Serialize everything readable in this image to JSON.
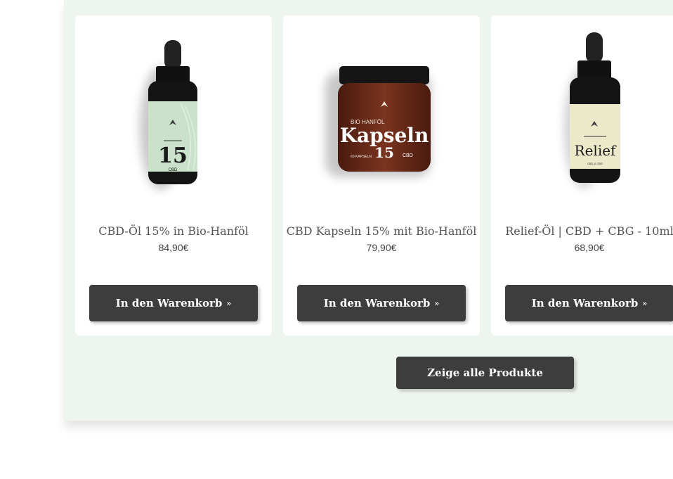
{
  "products": [
    {
      "title": "CBD-Öl 15% in Bio-Hanföl",
      "price": "84,90€",
      "button_label": "In den Warenkorb",
      "label_text": "15",
      "label_sub": "CBD",
      "label_color": "#c9e2c9"
    },
    {
      "title": "CBD Kapseln 15% mit Bio-Hanföl",
      "price": "79,90€",
      "button_label": "In den Warenkorb",
      "label_top": "BIO HANFÖL",
      "label_text": "Kapseln",
      "label_percent": "15",
      "label_sub": "CBD",
      "label_small": "60 KAPSELN",
      "jar_color": "#6a2a18"
    },
    {
      "title": "Relief-Öl | CBD + CBG - 10ml",
      "price": "68,90€",
      "button_label": "In den Warenkorb",
      "label_text": "Relief",
      "label_sub": "CBD & CBG",
      "label_color": "#ebe9c9"
    }
  ],
  "show_all_label": "Zeige alle Produkte",
  "colors": {
    "background": "#eef4ee",
    "card": "#ffffff",
    "button": "#3d3d3d",
    "button_text": "#ffffff"
  },
  "icons": {
    "button_chevron": "double-chevron-right-icon"
  }
}
